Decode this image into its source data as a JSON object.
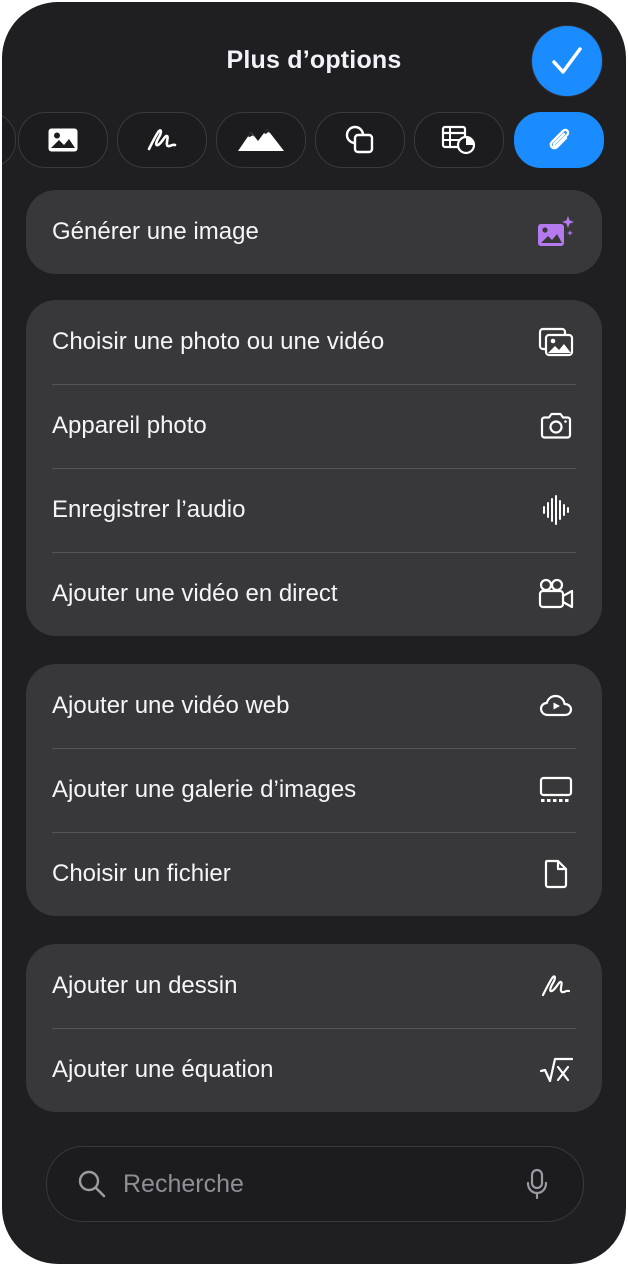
{
  "header": {
    "title": "Plus d’options"
  },
  "toolbar": {
    "tabs": [
      {
        "icon": "partial-tab-icon"
      },
      {
        "icon": "photo-icon"
      },
      {
        "icon": "scribble-icon"
      },
      {
        "icon": "mountains-icon"
      },
      {
        "icon": "shapes-icon"
      },
      {
        "icon": "table-chart-icon"
      },
      {
        "icon": "paperclip-icon",
        "selected": true
      }
    ],
    "accent": "#1a8cff"
  },
  "groups": [
    {
      "items": [
        {
          "label": "Générer une image",
          "icon": "image-sparkle-icon"
        }
      ]
    },
    {
      "items": [
        {
          "label": "Choisir une photo ou une vidéo",
          "icon": "photo-stack-icon"
        },
        {
          "label": "Appareil photo",
          "icon": "camera-icon"
        },
        {
          "label": "Enregistrer l’audio",
          "icon": "waveform-icon"
        },
        {
          "label": "Ajouter une vidéo en direct",
          "icon": "video-camera-icon"
        }
      ]
    },
    {
      "items": [
        {
          "label": "Ajouter une vidéo web",
          "icon": "cloud-play-icon"
        },
        {
          "label": "Ajouter une galerie d’images",
          "icon": "gallery-icon"
        },
        {
          "label": "Choisir un fichier",
          "icon": "file-icon"
        }
      ]
    },
    {
      "items": [
        {
          "label": "Ajouter un dessin",
          "icon": "scribble-icon"
        },
        {
          "label": "Ajouter une équation",
          "icon": "square-root-icon"
        }
      ]
    }
  ],
  "search": {
    "placeholder": "Recherche"
  }
}
